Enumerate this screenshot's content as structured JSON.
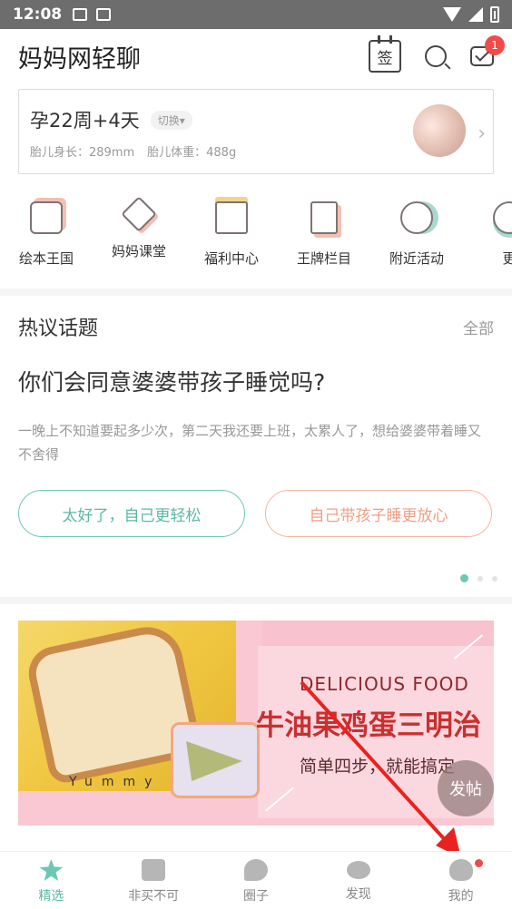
{
  "status_bar": {
    "time": "12:08"
  },
  "header": {
    "title": "妈妈网轻聊",
    "checkin_label": "签",
    "message_badge": "1"
  },
  "pregnancy": {
    "week_text": "孕22周+4天",
    "switch_label": "切换",
    "length_text": "胎儿身长：289mm",
    "weight_text": "胎儿体重：488g"
  },
  "quick_nav": [
    {
      "label": "绘本王国",
      "icon": "picture-book-icon"
    },
    {
      "label": "妈妈课堂",
      "icon": "classroom-icon"
    },
    {
      "label": "福利中心",
      "icon": "gift-icon"
    },
    {
      "label": "王牌栏目",
      "icon": "document-icon"
    },
    {
      "label": "附近活动",
      "icon": "balloon-icon"
    },
    {
      "label": "更",
      "icon": "more-icon"
    }
  ],
  "topics": {
    "heading": "热议话题",
    "all_label": "全部",
    "question": "你们会同意婆婆带孩子睡觉吗?",
    "description": "一晚上不知道要起多少次，第二天我还要上班，太累人了，想给婆婆带着睡又不舍得",
    "option_a": "太好了，自己更轻松",
    "option_b": "自己带孩子睡更放心"
  },
  "banner": {
    "english": "DELICIOUS  FOOD",
    "title": "牛油果鸡蛋三明治",
    "subtitle": "简单四步，就能搞定",
    "photo_text": "Yummy"
  },
  "fab_label": "发帖",
  "tabs": [
    {
      "label": "精选",
      "active": true
    },
    {
      "label": "非买不可",
      "active": false
    },
    {
      "label": "圈子",
      "active": false
    },
    {
      "label": "发现",
      "active": false
    },
    {
      "label": "我的",
      "active": false
    }
  ],
  "colors": {
    "accent": "#5ab9a4",
    "warm": "#ef9f86",
    "badge": "#f24b47"
  }
}
